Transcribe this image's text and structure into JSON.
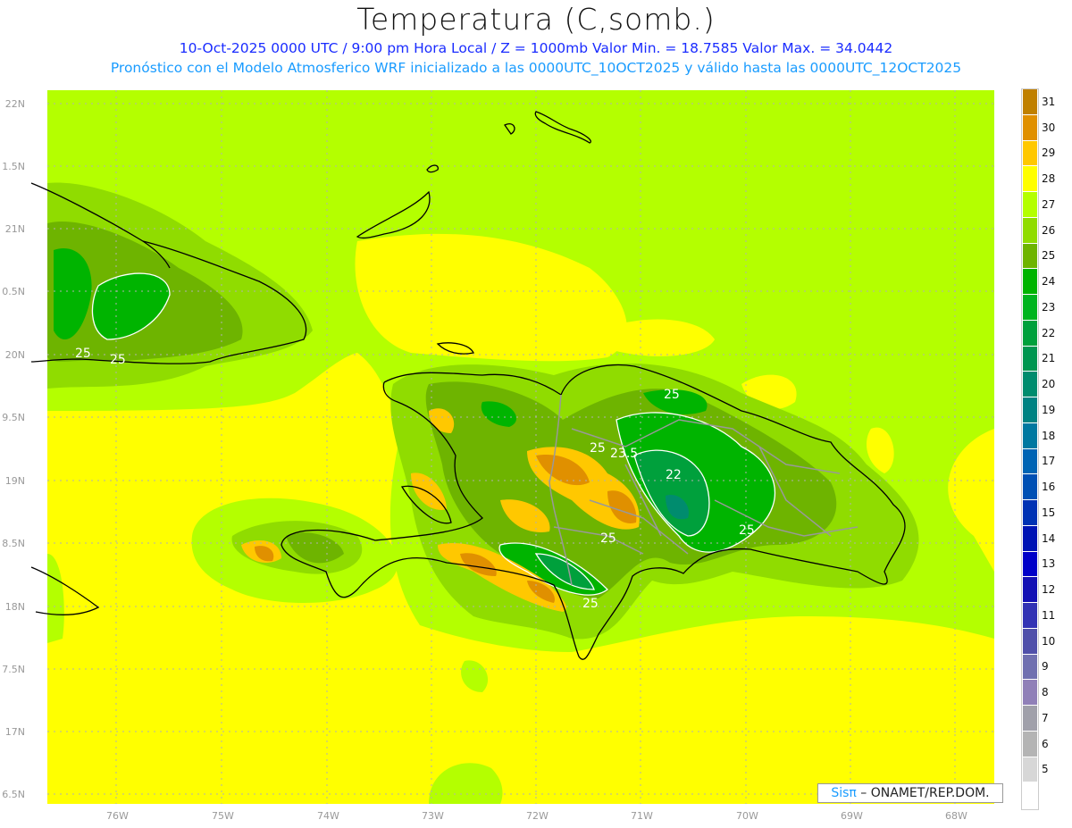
{
  "header": {
    "title": "Temperatura (C,somb.)",
    "line1": "10-Oct-2025  0000 UTC / 9:00 pm Hora Local / Z = 1000mb   Valor Min. = 18.7585  Valor Max. = 34.0442",
    "line2": "Pronóstico con el Modelo Atmosferico WRF inicializado a las 0000UTC_10OCT2025 y válido hasta las  0000UTC_12OCT2025"
  },
  "axes": {
    "lon_labels": [
      "76W",
      "75W",
      "74W",
      "73W",
      "72W",
      "71W",
      "70W",
      "69W",
      "68W"
    ],
    "lat_labels": [
      "22N",
      "1.5N",
      "21N",
      "0.5N",
      "20N",
      "9.5N",
      "19N",
      "8.5N",
      "18N",
      "7.5N",
      "17N",
      "6.5N"
    ]
  },
  "colorbar": {
    "labels": [
      "31",
      "30",
      "29",
      "28",
      "27",
      "26",
      "25",
      "24",
      "23",
      "22",
      "21",
      "20",
      "19",
      "18",
      "17",
      "16",
      "15",
      "14",
      "13",
      "12",
      "11",
      "10",
      "9",
      "8",
      "7",
      "6",
      "5"
    ],
    "colors": [
      "#c08000",
      "#e09000",
      "#ffc800",
      "#ffff00",
      "#b4ff00",
      "#90dc00",
      "#6eb400",
      "#00b400",
      "#00b41e",
      "#00a03c",
      "#009650",
      "#008c6e",
      "#008282",
      "#0078a0",
      "#0064b4",
      "#0050b4",
      "#0032b4",
      "#0014b4",
      "#0000c8",
      "#1410b4",
      "#3232b4",
      "#5050aa",
      "#7070b0",
      "#9080b8",
      "#a0a0aa",
      "#b4b4b4",
      "#d7d7d7",
      "#ffffff"
    ]
  },
  "contour_labels": [
    "25",
    "25",
    "25",
    "25",
    "23.5",
    "22",
    "25",
    "25",
    "25"
  ],
  "credit": {
    "logo": "Sisπ",
    "text": " – ONAMET/REP.DOM."
  }
}
